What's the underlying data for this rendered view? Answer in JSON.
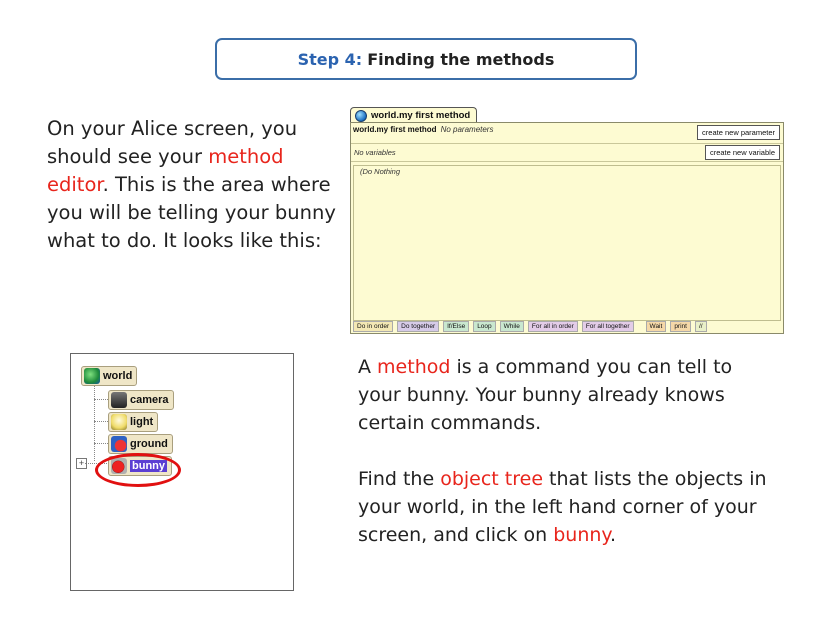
{
  "title": {
    "step": "Step 4:",
    "text": "Finding the methods"
  },
  "left_para": {
    "line1": "On your Alice screen, you",
    "line2a": "should see your ",
    "line2b": "method",
    "line3a": "editor",
    "line3b": ". This is the area where",
    "line4": "you will be telling your bunny",
    "line5": "what to do. It looks like this:"
  },
  "editor": {
    "tab_label": "world.my first method",
    "method_name": "world.my first method",
    "no_params": "No parameters",
    "no_vars": "No variables",
    "do_nothing": "(Do Nothing",
    "btn_param": "create new parameter",
    "btn_var": "create new variable",
    "toolbar": [
      "Do in order",
      "Do together",
      "If/Else",
      "Loop",
      "While",
      "For all in order",
      "For all together",
      "Wait",
      "print",
      "//"
    ]
  },
  "tree": {
    "world": "world",
    "camera": "camera",
    "light": "light",
    "ground": "ground",
    "bunny": "bunny"
  },
  "right_para": {
    "p1_a": "A ",
    "p1_b": "method",
    "p1_c": " is a command you can tell to",
    "p1_line2": "your bunny. Your bunny already knows",
    "p1_line3": "certain commands.",
    "p2_a": "Find the ",
    "p2_b": "object tree",
    "p2_c": " that lists the objects in",
    "p2_line2": "your world, in the left hand corner of your",
    "p2_line3a": "screen, and click on ",
    "p2_line3b": "bunny",
    "p2_line3c": "."
  },
  "colors": {
    "accent_red": "#e8251c",
    "title_blue": "#2b63b0",
    "editor_bg": "#fdfbd2"
  }
}
